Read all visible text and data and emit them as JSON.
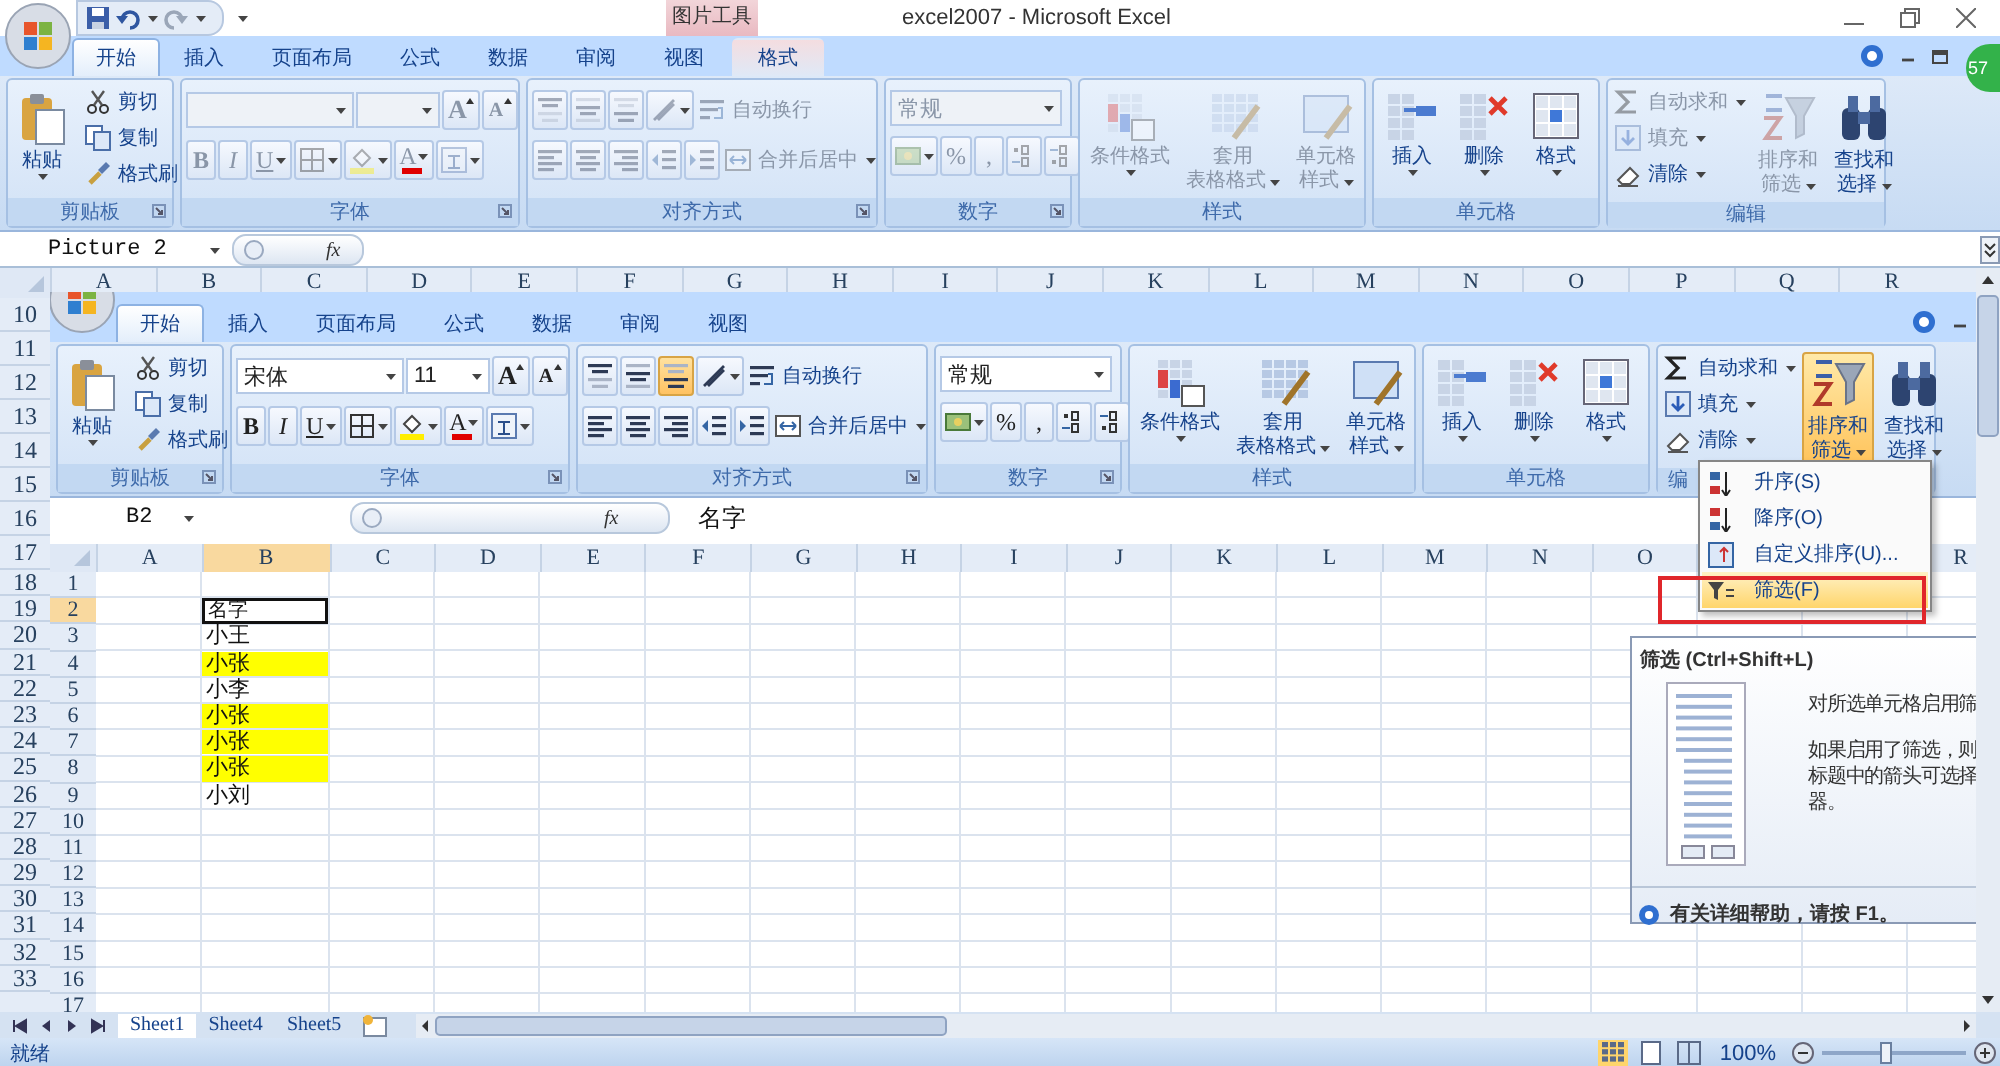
{
  "window": {
    "title": "excel2007 - Microsoft Excel",
    "context_group": "图片工具",
    "badge": "57"
  },
  "tabs": [
    {
      "label": "开始",
      "selected": true,
      "kind": "main"
    },
    {
      "label": "插入",
      "selected": false,
      "kind": "main"
    },
    {
      "label": "页面布局",
      "selected": false,
      "kind": "main"
    },
    {
      "label": "公式",
      "selected": false,
      "kind": "main"
    },
    {
      "label": "数据",
      "selected": false,
      "kind": "main"
    },
    {
      "label": "审阅",
      "selected": false,
      "kind": "main"
    },
    {
      "label": "视图",
      "selected": false,
      "kind": "main"
    },
    {
      "label": "格式",
      "selected": false,
      "kind": "context"
    }
  ],
  "ribbon": {
    "groups": [
      {
        "label": "剪贴板",
        "launcher": true,
        "parts": [
          {
            "kind": "large",
            "lines": [
              "粘贴"
            ],
            "dropdown": true,
            "disabled": false
          },
          {
            "kind": "stack",
            "items": [
              {
                "kind": "small",
                "label": "剪切",
                "disabled": false
              },
              {
                "kind": "small",
                "label": "复制",
                "disabled": false
              },
              {
                "kind": "small",
                "label": "格式刷",
                "disabled": false
              }
            ]
          }
        ]
      },
      {
        "label": "字体",
        "launcher": true,
        "parts": [
          {
            "kind": "tiers",
            "tiers": [
              [
                {
                  "kind": "combo",
                  "disabled": true
                },
                {
                  "kind": "combo",
                  "disabled": true
                },
                {
                  "kind": "grow",
                  "label": "A",
                  "disabled": true
                },
                {
                  "kind": "shrink",
                  "label": "A",
                  "disabled": true
                }
              ],
              [
                {
                  "kind": "bold",
                  "label": "B",
                  "disabled": true
                },
                {
                  "kind": "italic",
                  "label": "I",
                  "disabled": true
                },
                {
                  "kind": "underline",
                  "label": "U",
                  "dropdown": true,
                  "disabled": true
                },
                {
                  "kind": "icon",
                  "dropdown": true,
                  "disabled": true
                },
                {
                  "kind": "icon",
                  "dropdown": true,
                  "disabled": true
                },
                {
                  "kind": "color",
                  "label": "A",
                  "dropdown": true,
                  "disabled": true
                },
                {
                  "kind": "icon",
                  "dropdown": true,
                  "disabled": true
                }
              ]
            ]
          }
        ]
      },
      {
        "label": "对齐方式",
        "launcher": true,
        "parts": [
          {
            "kind": "tiers",
            "tiers": [
              [
                {
                  "kind": "icon",
                  "selected": false,
                  "disabled": true
                },
                {
                  "kind": "icon",
                  "selected": false,
                  "disabled": true
                },
                {
                  "kind": "icon",
                  "selected": false,
                  "disabled": true
                },
                {
                  "kind": "icon",
                  "dropdown": true,
                  "disabled": true
                },
                {
                  "kind": "small",
                  "label": "自动换行",
                  "disabled": true
                }
              ],
              [
                {
                  "kind": "icon",
                  "disabled": true
                },
                {
                  "kind": "icon",
                  "disabled": true
                },
                {
                  "kind": "icon",
                  "disabled": true
                },
                {
                  "kind": "icon",
                  "disabled": true
                },
                {
                  "kind": "icon",
                  "disabled": true
                },
                {
                  "kind": "small",
                  "label": "合并后居中",
                  "dropdown": true,
                  "disabled": true
                }
              ]
            ]
          }
        ]
      },
      {
        "label": "数字",
        "launcher": true,
        "parts": [
          {
            "kind": "tiers",
            "tiers": [
              [
                {
                  "kind": "combo",
                  "value": "常规",
                  "disabled": true
                }
              ],
              [
                {
                  "kind": "icon",
                  "dropdown": true,
                  "disabled": true
                },
                {
                  "kind": "glyph",
                  "label": "%",
                  "disabled": true
                },
                {
                  "kind": "glyph",
                  "label": ",",
                  "disabled": true
                },
                {
                  "kind": "icon",
                  "disabled": true
                },
                {
                  "kind": "icon",
                  "disabled": true
                }
              ]
            ]
          }
        ]
      },
      {
        "label": "样式",
        "parts": [
          {
            "kind": "large",
            "lines": [
              "条件格式"
            ],
            "dropdown": true,
            "disabled": true
          },
          {
            "kind": "large",
            "lines": [
              "套用",
              "表格格式"
            ],
            "dropdown": true,
            "disabled": true
          },
          {
            "kind": "large",
            "lines": [
              "单元格",
              "样式"
            ],
            "dropdown": true,
            "disabled": true
          }
        ]
      },
      {
        "label": "单元格",
        "parts": [
          {
            "kind": "large",
            "lines": [
              "插入"
            ],
            "dropdown": true,
            "disabled": false
          },
          {
            "kind": "large",
            "lines": [
              "删除"
            ],
            "dropdown": true,
            "disabled": false
          },
          {
            "kind": "large",
            "lines": [
              "格式"
            ],
            "dropdown": true,
            "disabled": false
          }
        ]
      },
      {
        "label": "编辑",
        "parts": [
          {
            "kind": "stack",
            "items": [
              {
                "kind": "small",
                "label": "自动求和",
                "dropdown": true,
                "disabled": true
              },
              {
                "kind": "small",
                "label": "填充",
                "dropdown": true,
                "disabled": true
              },
              {
                "kind": "small",
                "label": "清除",
                "dropdown": true,
                "disabled": false
              }
            ]
          },
          {
            "kind": "large",
            "lines": [
              "排序和",
              "筛选"
            ],
            "dropdown": true,
            "selected": false,
            "disabled": true
          },
          {
            "kind": "large",
            "lines": [
              "查找和",
              "选择"
            ],
            "dropdown": true,
            "selected": false,
            "disabled": false
          }
        ]
      }
    ]
  },
  "formula_bar": {
    "name_box": "Picture 2",
    "function_button": "fx"
  },
  "sheet": {
    "columns": [
      "A",
      "B",
      "C",
      "D",
      "E",
      "F",
      "G",
      "H",
      "I",
      "J",
      "K",
      "L",
      "M",
      "N",
      "O",
      "P",
      "Q",
      "R"
    ],
    "rows": [
      "10",
      "11",
      "12",
      "13",
      "14",
      "15",
      "16",
      "17",
      "18",
      "19",
      "20",
      "21",
      "22",
      "23",
      "24",
      "25",
      "26",
      "27",
      "28",
      "29",
      "30",
      "31",
      "32",
      "33"
    ]
  },
  "picture": {
    "tabs": [
      {
        "label": "开始",
        "selected": true,
        "kind": "main"
      },
      {
        "label": "插入",
        "selected": false,
        "kind": "main"
      },
      {
        "label": "页面布局",
        "selected": false,
        "kind": "main"
      },
      {
        "label": "公式",
        "selected": false,
        "kind": "main"
      },
      {
        "label": "数据",
        "selected": false,
        "kind": "main"
      },
      {
        "label": "审阅",
        "selected": false,
        "kind": "main"
      },
      {
        "label": "视图",
        "selected": false,
        "kind": "main"
      }
    ],
    "ribbon": {
      "groups": [
        {
          "label": "剪贴板",
          "launcher": true,
          "parts": [
            {
              "kind": "large",
              "lines": [
                "粘贴"
              ],
              "dropdown": true,
              "disabled": false
            },
            {
              "kind": "stack",
              "items": [
                {
                  "kind": "small",
                  "label": "剪切",
                  "disabled": false
                },
                {
                  "kind": "small",
                  "label": "复制",
                  "disabled": false
                },
                {
                  "kind": "small",
                  "label": "格式刷",
                  "disabled": false
                }
              ]
            }
          ]
        },
        {
          "label": "字体",
          "launcher": true,
          "parts": [
            {
              "kind": "tiers",
              "tiers": [
                [
                  {
                    "kind": "combo",
                    "value": "宋体",
                    "disabled": false
                  },
                  {
                    "kind": "combo",
                    "value": "11",
                    "disabled": false
                  },
                  {
                    "kind": "grow",
                    "label": "A",
                    "disabled": false
                  },
                  {
                    "kind": "shrink",
                    "label": "A",
                    "disabled": false
                  }
                ],
                [
                  {
                    "kind": "bold",
                    "label": "B",
                    "disabled": false
                  },
                  {
                    "kind": "italic",
                    "label": "I",
                    "disabled": false
                  },
                  {
                    "kind": "underline",
                    "label": "U",
                    "dropdown": true,
                    "disabled": false
                  },
                  {
                    "kind": "icon",
                    "dropdown": true,
                    "disabled": false
                  },
                  {
                    "kind": "icon",
                    "dropdown": true,
                    "disabled": false
                  },
                  {
                    "kind": "color",
                    "label": "A",
                    "dropdown": true,
                    "disabled": false
                  },
                  {
                    "kind": "icon",
                    "dropdown": true,
                    "disabled": false
                  }
                ]
              ]
            }
          ]
        },
        {
          "label": "对齐方式",
          "launcher": true,
          "parts": [
            {
              "kind": "tiers",
              "tiers": [
                [
                  {
                    "kind": "icon",
                    "selected": false,
                    "disabled": false
                  },
                  {
                    "kind": "icon",
                    "selected": false,
                    "disabled": false
                  },
                  {
                    "kind": "icon",
                    "selected": true,
                    "disabled": false
                  },
                  {
                    "kind": "icon",
                    "dropdown": true,
                    "disabled": false
                  },
                  {
                    "kind": "small",
                    "label": "自动换行",
                    "disabled": false
                  }
                ],
                [
                  {
                    "kind": "icon",
                    "disabled": false
                  },
                  {
                    "kind": "icon",
                    "disabled": false
                  },
                  {
                    "kind": "icon",
                    "disabled": false
                  },
                  {
                    "kind": "icon",
                    "disabled": false
                  },
                  {
                    "kind": "icon",
                    "disabled": false
                  },
                  {
                    "kind": "small",
                    "label": "合并后居中",
                    "dropdown": true,
                    "disabled": false
                  }
                ]
              ]
            }
          ]
        },
        {
          "label": "数字",
          "launcher": true,
          "parts": [
            {
              "kind": "tiers",
              "tiers": [
                [
                  {
                    "kind": "combo",
                    "value": "常规",
                    "disabled": false
                  }
                ],
                [
                  {
                    "kind": "icon",
                    "dropdown": true,
                    "disabled": false
                  },
                  {
                    "kind": "glyph",
                    "label": "%",
                    "disabled": false
                  },
                  {
                    "kind": "glyph",
                    "label": ",",
                    "disabled": false
                  },
                  {
                    "kind": "icon",
                    "disabled": false
                  },
                  {
                    "kind": "icon",
                    "disabled": false
                  }
                ]
              ]
            }
          ]
        },
        {
          "label": "样式",
          "parts": [
            {
              "kind": "large",
              "lines": [
                "条件格式"
              ],
              "dropdown": true,
              "disabled": false
            },
            {
              "kind": "large",
              "lines": [
                "套用",
                "表格格式"
              ],
              "dropdown": true,
              "disabled": false
            },
            {
              "kind": "large",
              "lines": [
                "单元格",
                "样式"
              ],
              "dropdown": true,
              "disabled": false
            }
          ]
        },
        {
          "label": "单元格",
          "parts": [
            {
              "kind": "large",
              "lines": [
                "插入"
              ],
              "dropdown": true,
              "disabled": false
            },
            {
              "kind": "large",
              "lines": [
                "删除"
              ],
              "dropdown": true,
              "disabled": false
            },
            {
              "kind": "large",
              "lines": [
                "格式"
              ],
              "dropdown": true,
              "disabled": false
            }
          ]
        },
        {
          "label": "编",
          "parts": [
            {
              "kind": "stack",
              "items": [
                {
                  "kind": "small",
                  "label": "自动求和",
                  "dropdown": true,
                  "disabled": false
                },
                {
                  "kind": "small",
                  "label": "填充",
                  "dropdown": true,
                  "disabled": false
                },
                {
                  "kind": "small",
                  "label": "清除",
                  "dropdown": true,
                  "disabled": false
                }
              ]
            },
            {
              "kind": "large",
              "lines": [
                "排序和",
                "筛选"
              ],
              "dropdown": true,
              "selected": true,
              "disabled": false
            },
            {
              "kind": "large",
              "lines": [
                "查找和",
                "选择"
              ],
              "dropdown": true,
              "selected": false,
              "disabled": false
            }
          ]
        }
      ]
    },
    "formula_bar": {
      "name_box": "B2",
      "function_button": "fx",
      "value": "名字"
    },
    "sheet": {
      "columns": [
        {
          "label": "A",
          "selected": false
        },
        {
          "label": "B",
          "selected": true
        },
        {
          "label": "C",
          "selected": false
        },
        {
          "label": "D",
          "selected": false
        },
        {
          "label": "E",
          "selected": false
        },
        {
          "label": "F",
          "selected": false
        },
        {
          "label": "G",
          "selected": false
        },
        {
          "label": "H",
          "selected": false
        },
        {
          "label": "I",
          "selected": false
        },
        {
          "label": "J",
          "selected": false
        },
        {
          "label": "K",
          "selected": false
        },
        {
          "label": "L",
          "selected": false
        },
        {
          "label": "M",
          "selected": false
        },
        {
          "label": "N",
          "selected": false
        },
        {
          "label": "O",
          "selected": false
        },
        {},
        {},
        {
          "label": "R",
          "selected": false
        }
      ],
      "rows": [
        {
          "label": "1",
          "selected": false
        },
        {
          "label": "2",
          "selected": true,
          "value": "名字"
        },
        {
          "label": "3",
          "selected": false,
          "value": "小王"
        },
        {
          "label": "4",
          "selected": false,
          "value": "小张",
          "color": "#ffff00"
        },
        {
          "label": "5",
          "selected": false,
          "value": "小李"
        },
        {
          "label": "6",
          "selected": false,
          "value": "小张",
          "color": "#ffff00"
        },
        {
          "label": "7",
          "selected": false,
          "value": "小张",
          "color": "#ffff00"
        },
        {
          "label": "8",
          "selected": false,
          "value": "小张",
          "color": "#ffff00"
        },
        {
          "label": "9",
          "selected": false,
          "value": "小刘"
        },
        {
          "label": "10",
          "selected": false
        },
        {
          "label": "11",
          "selected": false
        },
        {
          "label": "12",
          "selected": false
        },
        {
          "label": "13",
          "selected": false
        },
        {
          "label": "14",
          "selected": false
        },
        {
          "label": "15",
          "selected": false
        },
        {
          "label": "16",
          "selected": false
        },
        {
          "label": "17",
          "selected": false
        }
      ]
    },
    "sort_menu": {
      "items": [
        {
          "label": "升序(S)",
          "selected": false
        },
        {
          "label": "降序(O)",
          "selected": false
        },
        {
          "label": "自定义排序(U)...",
          "selected": false
        },
        {
          "label": "筛选(F)",
          "selected": true
        }
      ]
    },
    "tooltip": {
      "title": "筛选 (Ctrl+Shift+L)",
      "lines": [
        "对所选单元格启用筛",
        "如果启用了筛选，则",
        "标题中的箭头可选择",
        "器。"
      ],
      "help": "有关详细帮助，请按 F1。"
    }
  },
  "sheet_tabs": [
    {
      "label": "Sheet1",
      "selected": true
    },
    {
      "label": "Sheet4",
      "selected": false
    },
    {
      "label": "Sheet5",
      "selected": false
    }
  ],
  "status_bar": {
    "text": "就绪",
    "views": [
      {
        "selected": true
      },
      {
        "selected": false
      },
      {
        "selected": false
      }
    ],
    "zoom": "100%",
    "zoom_slider": {
      "level": 0.45
    }
  }
}
